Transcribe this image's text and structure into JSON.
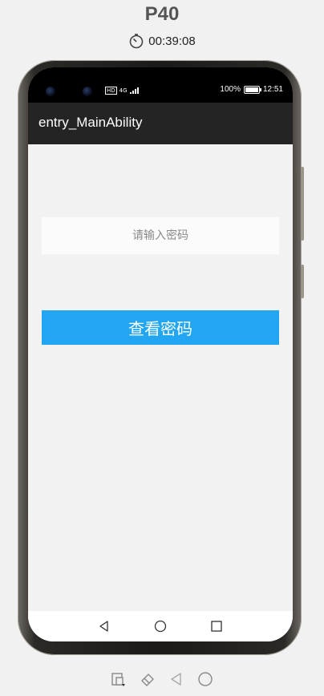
{
  "device": {
    "name": "P40",
    "timer": "00:39:08"
  },
  "status_bar": {
    "network": "HD",
    "signal": "4G",
    "battery": "100%",
    "time": "12:51"
  },
  "app_bar": {
    "title": "entry_MainAbility"
  },
  "form": {
    "password_placeholder": "请输入密码",
    "password_value": "",
    "view_button_label": "查看密码"
  },
  "colors": {
    "app_bar_bg": "#242424",
    "button_bg": "#22a6f2",
    "button_text": "#ffffff"
  },
  "nav": {
    "icons": [
      "back-triangle-icon",
      "home-circle-icon",
      "recents-square-icon"
    ]
  },
  "toolbar": {
    "icons": [
      "rotate-screen-icon",
      "eraser-icon",
      "back-icon",
      "home-icon"
    ]
  }
}
